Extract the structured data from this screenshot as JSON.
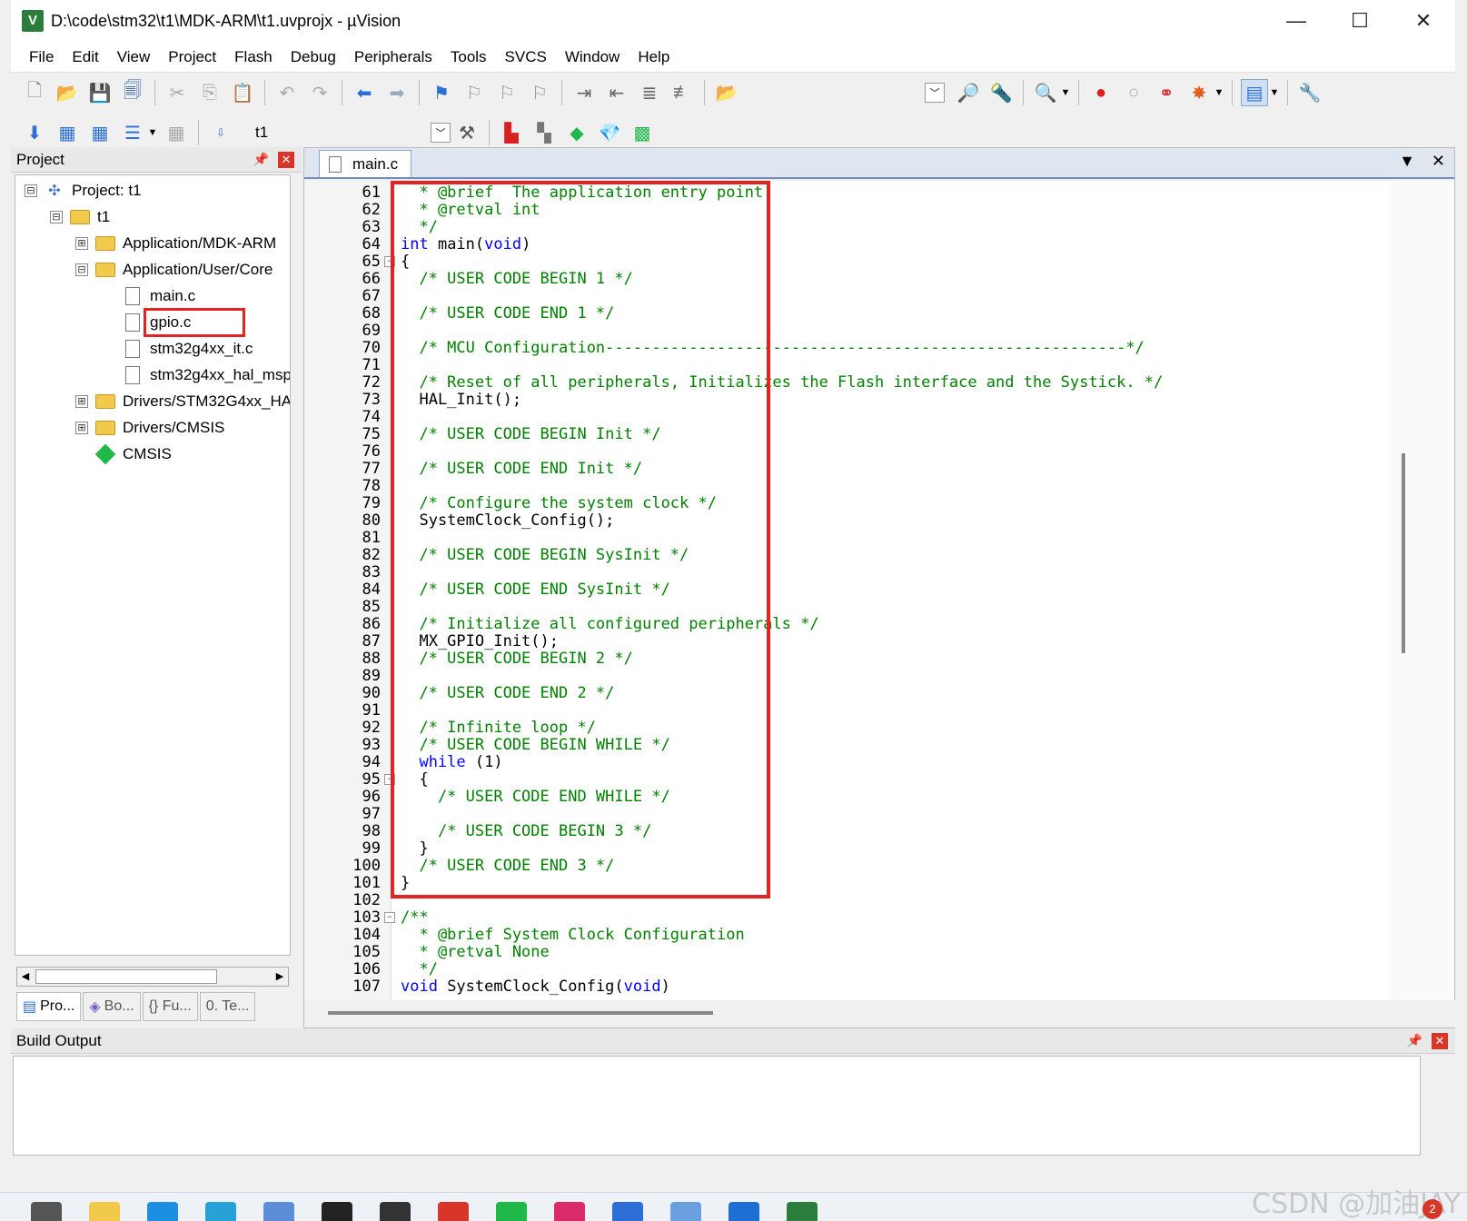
{
  "window": {
    "title": "D:\\code\\stm32\\t1\\MDK-ARM\\t1.uvprojx - µVision",
    "minimize": "—",
    "maximize": "☐",
    "close": "✕"
  },
  "menu": [
    "File",
    "Edit",
    "View",
    "Project",
    "Flash",
    "Debug",
    "Peripherals",
    "Tools",
    "SVCS",
    "Window",
    "Help"
  ],
  "toolbar2": {
    "target": "t1"
  },
  "project_panel": {
    "title": "Project",
    "tree": [
      {
        "label": "Project: t1",
        "kind": "project",
        "expander": "⊟"
      },
      {
        "label": "t1",
        "kind": "target",
        "expander": "⊟"
      },
      {
        "label": "Application/MDK-ARM",
        "kind": "folder",
        "expander": "⊞"
      },
      {
        "label": "Application/User/Core",
        "kind": "folder",
        "expander": "⊟"
      },
      {
        "label": "main.c",
        "kind": "file",
        "expander": ""
      },
      {
        "label": "gpio.c",
        "kind": "file",
        "expander": ""
      },
      {
        "label": "stm32g4xx_it.c",
        "kind": "file",
        "expander": ""
      },
      {
        "label": "stm32g4xx_hal_msp",
        "kind": "file",
        "expander": ""
      },
      {
        "label": "Drivers/STM32G4xx_HA",
        "kind": "folder",
        "expander": "⊞"
      },
      {
        "label": "Drivers/CMSIS",
        "kind": "folder",
        "expander": "⊞"
      },
      {
        "label": "CMSIS",
        "kind": "component",
        "expander": ""
      }
    ],
    "tabs": [
      "Pro...",
      "Bo...",
      "{} Fu...",
      "0. Te..."
    ]
  },
  "editor": {
    "active_tab": "main.c",
    "lines": [
      {
        "n": "61",
        "parts": [
          [
            "cm",
            "  * @brief  The application entry point."
          ]
        ]
      },
      {
        "n": "62",
        "parts": [
          [
            "cm",
            "  * @retval int"
          ]
        ]
      },
      {
        "n": "63",
        "parts": [
          [
            "cm",
            "  */"
          ]
        ]
      },
      {
        "n": "64",
        "parts": [
          [
            "kw",
            "int"
          ],
          [
            "tx",
            " main("
          ],
          [
            "kw",
            "void"
          ],
          [
            "tx",
            ")"
          ]
        ]
      },
      {
        "n": "65",
        "fold": true,
        "parts": [
          [
            "tx",
            "{"
          ]
        ]
      },
      {
        "n": "66",
        "parts": [
          [
            "cm",
            "  /* USER CODE BEGIN 1 */"
          ]
        ]
      },
      {
        "n": "67",
        "parts": []
      },
      {
        "n": "68",
        "parts": [
          [
            "cm",
            "  /* USER CODE END 1 */"
          ]
        ]
      },
      {
        "n": "69",
        "parts": []
      },
      {
        "n": "70",
        "parts": [
          [
            "cm",
            "  /* MCU Configuration--------------------------------------------------------*/"
          ]
        ]
      },
      {
        "n": "71",
        "parts": []
      },
      {
        "n": "72",
        "parts": [
          [
            "cm",
            "  /* Reset of all peripherals, Initializes the Flash interface and the Systick. */"
          ]
        ]
      },
      {
        "n": "73",
        "parts": [
          [
            "tx",
            "  HAL_Init();"
          ]
        ]
      },
      {
        "n": "74",
        "parts": []
      },
      {
        "n": "75",
        "parts": [
          [
            "cm",
            "  /* USER CODE BEGIN Init */"
          ]
        ]
      },
      {
        "n": "76",
        "parts": []
      },
      {
        "n": "77",
        "parts": [
          [
            "cm",
            "  /* USER CODE END Init */"
          ]
        ]
      },
      {
        "n": "78",
        "parts": []
      },
      {
        "n": "79",
        "parts": [
          [
            "cm",
            "  /* Configure the system clock */"
          ]
        ]
      },
      {
        "n": "80",
        "parts": [
          [
            "tx",
            "  SystemClock_Config();"
          ]
        ]
      },
      {
        "n": "81",
        "parts": []
      },
      {
        "n": "82",
        "parts": [
          [
            "cm",
            "  /* USER CODE BEGIN SysInit */"
          ]
        ]
      },
      {
        "n": "83",
        "parts": []
      },
      {
        "n": "84",
        "parts": [
          [
            "cm",
            "  /* USER CODE END SysInit */"
          ]
        ]
      },
      {
        "n": "85",
        "parts": []
      },
      {
        "n": "86",
        "parts": [
          [
            "cm",
            "  /* Initialize all configured peripherals */"
          ]
        ]
      },
      {
        "n": "87",
        "parts": [
          [
            "tx",
            "  MX_GPIO_Init();"
          ]
        ]
      },
      {
        "n": "88",
        "parts": [
          [
            "cm",
            "  /* USER CODE BEGIN 2 */"
          ]
        ]
      },
      {
        "n": "89",
        "parts": []
      },
      {
        "n": "90",
        "parts": [
          [
            "cm",
            "  /* USER CODE END 2 */"
          ]
        ]
      },
      {
        "n": "91",
        "parts": []
      },
      {
        "n": "92",
        "parts": [
          [
            "cm",
            "  /* Infinite loop */"
          ]
        ]
      },
      {
        "n": "93",
        "parts": [
          [
            "cm",
            "  /* USER CODE BEGIN WHILE */"
          ]
        ]
      },
      {
        "n": "94",
        "parts": [
          [
            "kw",
            "  while"
          ],
          [
            "tx",
            " (1)"
          ]
        ]
      },
      {
        "n": "95",
        "fold": true,
        "parts": [
          [
            "tx",
            "  {"
          ]
        ]
      },
      {
        "n": "96",
        "parts": [
          [
            "cm",
            "    /* USER CODE END WHILE */"
          ]
        ]
      },
      {
        "n": "97",
        "parts": []
      },
      {
        "n": "98",
        "parts": [
          [
            "cm",
            "    /* USER CODE BEGIN 3 */"
          ]
        ]
      },
      {
        "n": "99",
        "parts": [
          [
            "tx",
            "  }"
          ]
        ]
      },
      {
        "n": "100",
        "parts": [
          [
            "cm",
            "  /* USER CODE END 3 */"
          ]
        ]
      },
      {
        "n": "101",
        "parts": [
          [
            "tx",
            "}"
          ]
        ]
      },
      {
        "n": "102",
        "parts": []
      },
      {
        "n": "103",
        "fold": true,
        "parts": [
          [
            "cm",
            "/**"
          ]
        ]
      },
      {
        "n": "104",
        "parts": [
          [
            "cm",
            "  * @brief System Clock Configuration"
          ]
        ]
      },
      {
        "n": "105",
        "parts": [
          [
            "cm",
            "  * @retval None"
          ]
        ]
      },
      {
        "n": "106",
        "parts": [
          [
            "cm",
            "  */"
          ]
        ]
      },
      {
        "n": "107",
        "parts": [
          [
            "kw",
            "void"
          ],
          [
            "tx",
            " SystemClock_Config("
          ],
          [
            "kw",
            "void"
          ],
          [
            "tx",
            ")"
          ]
        ]
      }
    ]
  },
  "build_output": {
    "title": "Build Output"
  },
  "watermark": "CSDN @加油JAY",
  "taskbar": {
    "badge": "2"
  },
  "colors": {
    "highlight": "#e52222",
    "comment": "#008000",
    "keyword": "#0000ff"
  }
}
